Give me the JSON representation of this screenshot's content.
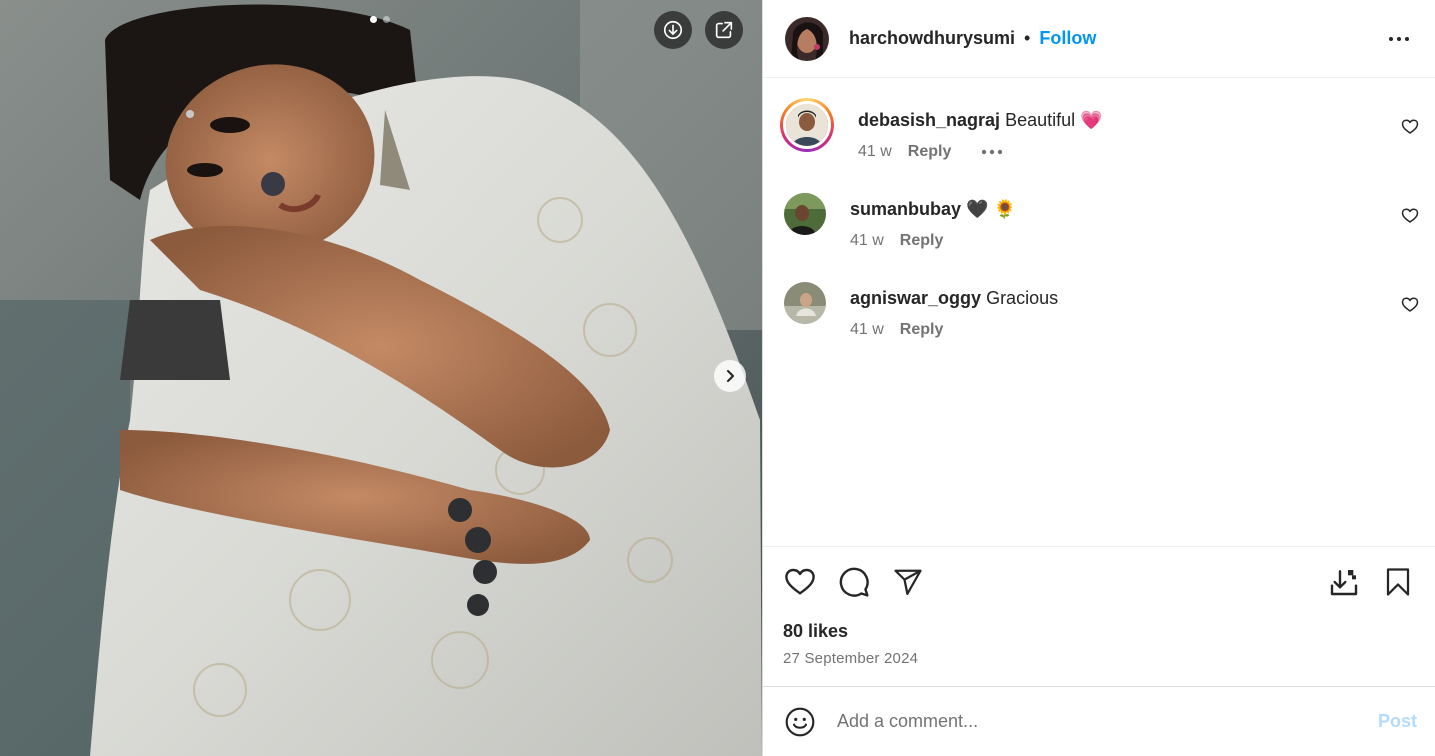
{
  "post": {
    "carousel_total": 2,
    "carousel_index": 1
  },
  "header": {
    "username": "harchowdhurysumi",
    "separator": "•",
    "follow_label": "Follow"
  },
  "comments": [
    {
      "user": "debasish_nagraj",
      "text": "Beautiful",
      "emoji": "💗",
      "time": "41 w",
      "reply_label": "Reply",
      "has_story_ring": true
    },
    {
      "user": "sumanbubay",
      "text": "",
      "emoji": "🖤 🌻",
      "time": "41 w",
      "reply_label": "Reply",
      "has_story_ring": false
    },
    {
      "user": "agniswar_oggy",
      "text": "Gracious",
      "emoji": "",
      "time": "41 w",
      "reply_label": "Reply",
      "has_story_ring": false
    }
  ],
  "footer": {
    "likes": "80 likes",
    "date": "27 September 2024"
  },
  "composer": {
    "placeholder": "Add a comment...",
    "post_label": "Post"
  },
  "icons": {
    "download": "download-icon",
    "external": "external-link-icon",
    "next": "chevron-right-icon",
    "more": "more-horizontal-icon",
    "like": "heart-outline-icon",
    "comment": "comment-bubble-icon",
    "share": "paper-plane-icon",
    "save_to_collection": "save-download-icon",
    "bookmark": "bookmark-icon",
    "emoji": "smiley-icon"
  },
  "colors": {
    "accent": "#0095f6",
    "post_disabled": "#b3dbff",
    "meta_text": "#737373"
  }
}
